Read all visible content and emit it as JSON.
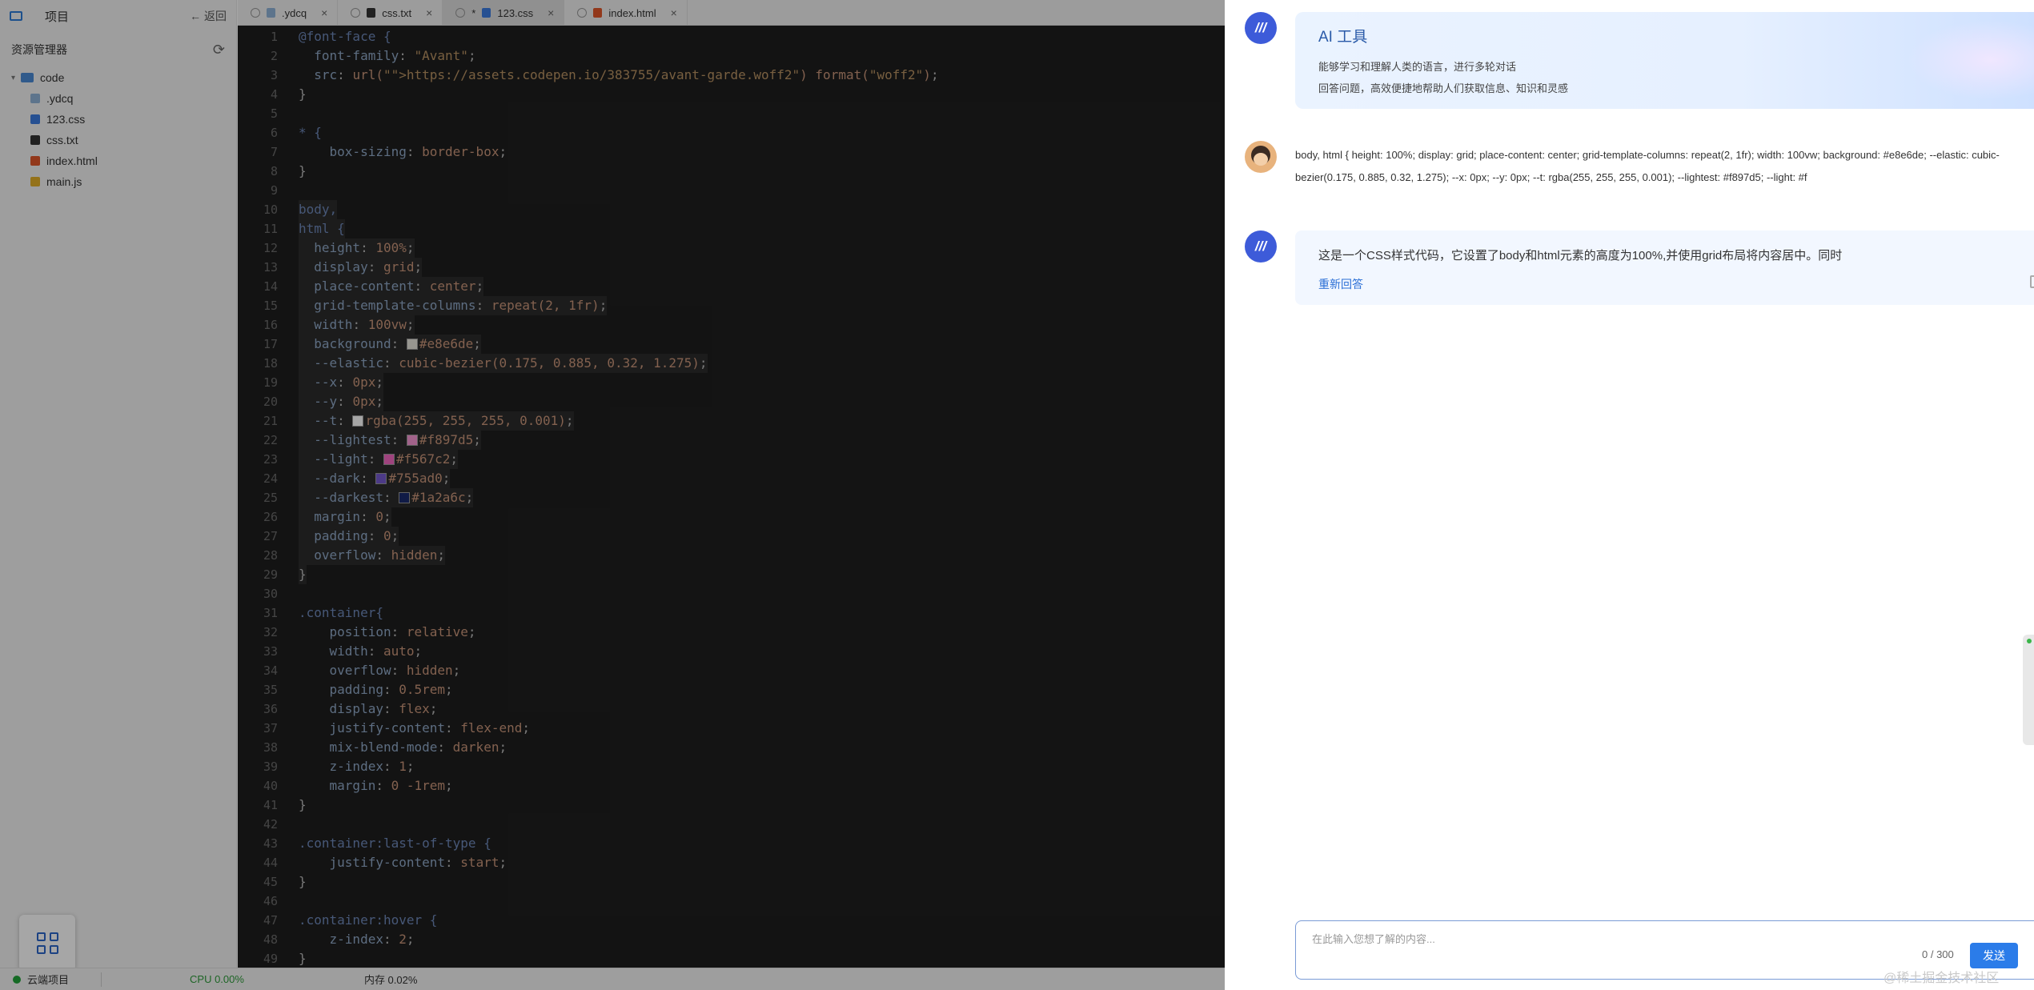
{
  "explorer": {
    "project_label": "项目",
    "back_label": "← 返回",
    "title": "资源管理器",
    "root_folder": "code",
    "files": [
      {
        "name": ".ydcq",
        "type": "ydcq"
      },
      {
        "name": "123.css",
        "type": "css"
      },
      {
        "name": "css.txt",
        "type": "txt"
      },
      {
        "name": "index.html",
        "type": "html"
      },
      {
        "name": "main.js",
        "type": "js"
      }
    ]
  },
  "tabs": [
    {
      "label": ".ydcq",
      "type": "ydcq",
      "active": false
    },
    {
      "label": "css.txt",
      "type": "txt",
      "active": false
    },
    {
      "label": "123.css",
      "type": "css",
      "active": true,
      "modified_mark": "*"
    },
    {
      "label": "index.html",
      "type": "html",
      "active": false
    }
  ],
  "code_lines": [
    "@font-face {",
    "  font-family: \"Avant\";",
    "  src: url(\"https://assets.codepen.io/383755/avant-garde.woff2\") format(\"woff2\");",
    "}",
    "",
    "* {",
    "    box-sizing: border-box;",
    "}",
    "",
    "body,",
    "html {",
    "  height: 100%;",
    "  display: grid;",
    "  place-content: center;",
    "  grid-template-columns: repeat(2, 1fr);",
    "  width: 100vw;",
    "  background: #e8e6de;",
    "  --elastic: cubic-bezier(0.175, 0.885, 0.32, 1.275);",
    "  --x: 0px;",
    "  --y: 0px;",
    "  --t: rgba(255, 255, 255, 0.001);",
    "  --lightest: #f897d5;",
    "  --light: #f567c2;",
    "  --dark: #755ad0;",
    "  --darkest: #1a2a6c;",
    "  margin: 0;",
    "  padding: 0;",
    "  overflow: hidden;",
    "}",
    "",
    ".container{",
    "    position: relative;",
    "    width: auto;",
    "    overflow: hidden;",
    "    padding: 0.5rem;",
    "    display: flex;",
    "    justify-content: flex-end;",
    "    mix-blend-mode: darken;",
    "    z-index: 1;",
    "    margin: 0 -1rem;",
    "}",
    "",
    ".container:last-of-type {",
    "    justify-content: start;",
    "}",
    "",
    ".container:hover {",
    "    z-index: 2;",
    "}"
  ],
  "swatches": {
    "17": "#e8e6de",
    "21": "#ffffff",
    "22": "#f897d5",
    "23": "#f567c2",
    "24": "#755ad0",
    "25": "#1a2a6c"
  },
  "status": {
    "project": "云端项目",
    "cpu": "CPU 0.00%",
    "memory": "内存 0.02%"
  },
  "ai": {
    "title": "AI 工具",
    "desc1": "能够学习和理解人类的语言，进行多轮对话",
    "desc2": "回答问题，高效便捷地帮助人们获取信息、知识和灵感",
    "user_message": "body, html { height: 100%; display: grid; place-content: center; grid-template-columns: repeat(2, 1fr); width: 100vw; background: #e8e6de; --elastic: cubic-bezier(0.175, 0.885, 0.32, 1.275); --x: 0px; --y: 0px; --t: rgba(255, 255, 255, 0.001); --lightest: #f897d5; --light: #f",
    "bot_reply": "这是一个CSS样式代码，它设置了body和html元素的高度为100%,并使用grid布局将内容居中。同时",
    "regenerate": "重新回答",
    "input_placeholder": "在此输入您想了解的内容...",
    "counter": "0 / 300",
    "send": "发送",
    "watermark": "@稀土掘金技术社区"
  },
  "colors": {
    "accent": "#2b7ce9",
    "editor_bg": "#1e1e1e"
  }
}
